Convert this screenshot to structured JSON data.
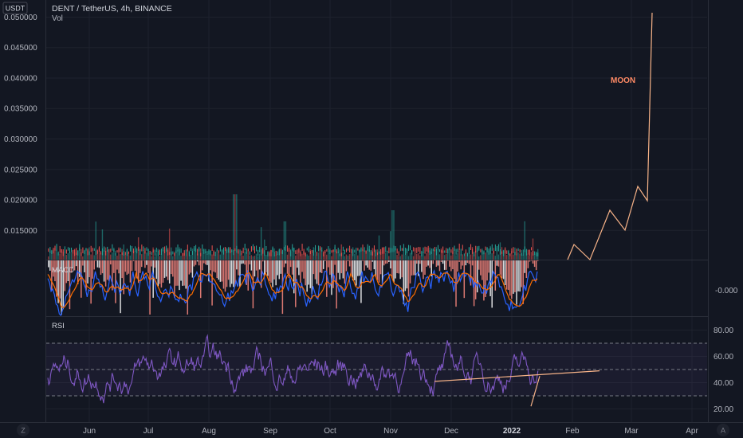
{
  "header": {
    "currency_badge": "USDT",
    "title": "DENT / TetherUS, 4h, BINANCE",
    "vol_label": "Vol"
  },
  "colors": {
    "background": "#131722",
    "up": "#26a69a",
    "down": "#ef5350",
    "macd": "#2962ff",
    "signal": "#ff6d00",
    "rsi": "#7e57c2",
    "drawing": "#f7b388",
    "moon_text": "#ff8a65"
  },
  "annotation": {
    "moon": "MOON"
  },
  "panes": {
    "macd_label": "MACD",
    "macd_axis_value": "-0.000",
    "rsi_label": "RSI"
  },
  "footer": {
    "timezone_button": "Z",
    "log_button": "A"
  },
  "chart_data": [
    {
      "type": "line",
      "pane": "price",
      "ylim": [
        0.0102,
        0.0515
      ],
      "ticks": [
        "0.050000",
        "0.045000",
        "0.040000",
        "0.035000",
        "0.030000",
        "0.025000",
        "0.020000",
        "0.015000"
      ],
      "tick_values": [
        0.05,
        0.045,
        0.04,
        0.035,
        0.03,
        0.025,
        0.02,
        0.015
      ],
      "x_ticks": [
        "Jun",
        "Jul",
        "Aug",
        "Sep",
        "Oct",
        "Nov",
        "Dec",
        "2022",
        "Feb",
        "Mar",
        "Apr"
      ],
      "drawing_path_x_months": [
        8.5,
        8.88,
        9.05,
        9.6,
        9.88,
        10.25,
        10.55,
        10.68,
        10.92,
        10.98
      ],
      "drawing_path_y": [
        0.0101,
        0.013,
        0.0102,
        0.0188,
        0.0155,
        0.0225,
        0.0205,
        0.051
      ]
    },
    {
      "type": "line",
      "pane": "rsi",
      "ylim": [
        10,
        90
      ],
      "ticks": [
        "80.00",
        "60.00",
        "40.00",
        "20.00"
      ],
      "tick_values": [
        80,
        60,
        40,
        20
      ],
      "bands": [
        70,
        50,
        30
      ]
    }
  ]
}
